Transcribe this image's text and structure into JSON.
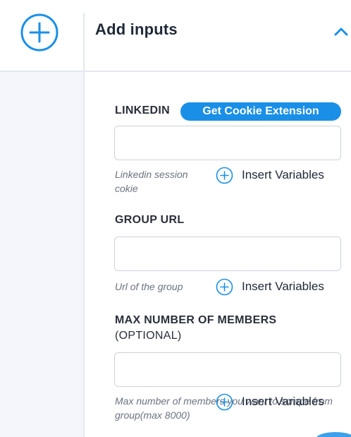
{
  "header": {
    "title": "Add inputs"
  },
  "linkedin": {
    "label": "LINKEDIN",
    "cookie_button": "Get Cookie Extension",
    "value": "",
    "hint": "Linkedin session cokie",
    "insert_label": "Insert Variables"
  },
  "group_url": {
    "label": "GROUP URL",
    "value": "",
    "hint": "Url of the group",
    "insert_label": "Insert Variables"
  },
  "max_members": {
    "label": "MAX NUMBER OF MEMBERS",
    "optional": "(OPTIONAL)",
    "value": "",
    "hint": "Max number of members you want to scrape from group(max 8000)",
    "insert_label": "Insert Variables"
  },
  "icons": {
    "add": "plus-circle-icon",
    "collapse": "chevron-up-icon",
    "insert": "plus-circle-icon"
  },
  "colors": {
    "accent": "#1a8fe8",
    "rail_background": "#f4f6fb",
    "divider": "#e3e7ef"
  }
}
